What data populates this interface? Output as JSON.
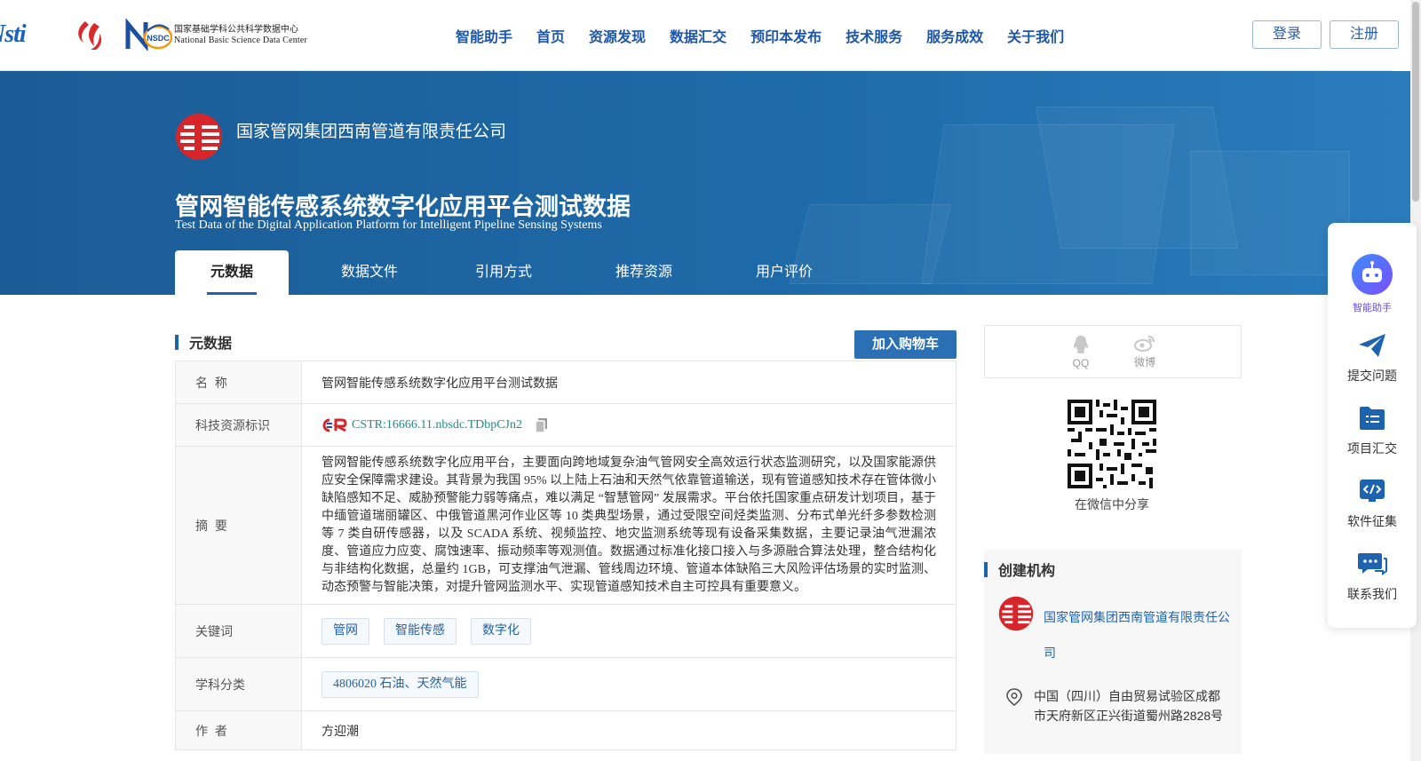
{
  "header": {
    "logo_nsti": "Nsti",
    "logo_nsdc_cn": "国家基础学科公共科学数据中心",
    "logo_nsdc_en": "National Basic Science Data Center",
    "nsdc_mark": "NSDC",
    "nav": [
      "智能助手",
      "首页",
      "资源发现",
      "数据汇交",
      "预印本发布",
      "技术服务",
      "服务成效",
      "关于我们"
    ],
    "login": "登录",
    "register": "注册"
  },
  "hero": {
    "org": "国家管网集团西南管道有限责任公司",
    "title": "管网智能传感系统数字化应用平台测试数据",
    "subtitle": "Test Data of the Digital Application Platform for Intelligent Pipeline Sensing Systems",
    "tabs": [
      "元数据",
      "数据文件",
      "引用方式",
      "推荐资源",
      "用户评价"
    ],
    "active_tab": 0
  },
  "metadata": {
    "heading": "元数据",
    "cart": "加入购物车",
    "rows": {
      "name_label": "名  称",
      "name": "管网智能传感系统数字化应用平台测试数据",
      "id_label": "科技资源标识",
      "cstr": "CSTR:16666.11.nbsdc.TDbpCJn2",
      "abstract_label": "摘  要",
      "abstract": "管网智能传感系统数字化应用平台，主要面向跨地域复杂油气管网安全高效运行状态监测研究，以及国家能源供应安全保障需求建设。其背景为我国 95% 以上陆上石油和天然气依靠管道输送，现有管道感知技术存在管体微小缺陷感知不足、威胁预警能力弱等痛点，难以满足 “智慧管网” 发展需求。平台依托国家重点研发计划项目，基于中缅管道瑞丽罐区、中俄管道黑河作业区等 10 类典型场景，通过受限空间烃类监测、分布式单光纤多参数检测等 7 类自研传感器，以及 SCADA 系统、视频监控、地灾监测系统等现有设备采集数据，主要记录油气泄漏浓度、管道应力应变、腐蚀速率、振动频率等观测值。数据通过标准化接口接入与多源融合算法处理，整合结构化与非结构化数据，总量约 1GB，可支撑油气泄漏、管线周边环境、管道本体缺陷三大风险评估场景的实时监测、动态预警与智能决策，对提升管网监测水平、实现管道感知技术自主可控具有重要意义。",
      "keywords_label": "关键词",
      "keywords": [
        "管网",
        "智能传感",
        "数字化"
      ],
      "subject_label": "学科分类",
      "subject": "4806020 石油、天然气能",
      "author_label": "作  者",
      "author": "方迎潮"
    }
  },
  "side": {
    "share": [
      {
        "label": "QQ",
        "icon": "qq-icon"
      },
      {
        "label": "微博",
        "icon": "weibo-icon"
      }
    ],
    "qr_caption": "在微信中分享",
    "org_heading": "创建机构",
    "org_name": "国家管网集团西南管道有限责任公司",
    "org_address": "中国（四川）自由贸易试验区成都市天府新区正兴街道蜀州路2828号"
  },
  "float_panel": {
    "items": [
      "智能助手",
      "提交问题",
      "项目汇交",
      "软件征集",
      "联系我们"
    ]
  },
  "colors": {
    "brand_blue": "#1e63b0",
    "hero_bg": "#1b5c96",
    "cstr_teal": "#1a8c8c",
    "org_red": "#d6262b"
  }
}
